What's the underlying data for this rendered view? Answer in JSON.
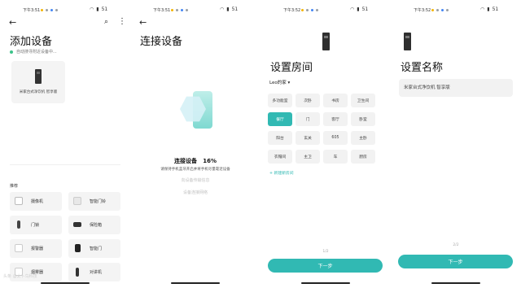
{
  "status": {
    "time_1": "下午3:51",
    "time_2": "下午3:51",
    "time_3": "下午3:52",
    "time_4": "下午3:52",
    "battery": "51"
  },
  "panel1": {
    "title": "添加设备",
    "searching": "自动搜寻附近设备中...",
    "found_device": "米家台式净饮机 智享版",
    "category_faded": "",
    "category": "推荐",
    "devices": [
      {
        "label": "摄像机",
        "icon": "camera-icon"
      },
      {
        "label": "智能门铃",
        "icon": "doorbell-icon"
      },
      {
        "label": "门锁",
        "icon": "door-lock-icon"
      },
      {
        "label": "保险箱",
        "icon": "safe-icon"
      },
      {
        "label": "报警器",
        "icon": "alarm-icon"
      },
      {
        "label": "智能门",
        "icon": "smart-door-icon"
      },
      {
        "label": "烟雾器",
        "icon": "smoke-detector-icon"
      },
      {
        "label": "对讲机",
        "icon": "walkie-talkie-icon"
      }
    ],
    "watermark": "头条 @太卜鸟科技"
  },
  "panel2": {
    "title": "连接设备",
    "progress_label": "连接设备",
    "progress_value": "16%",
    "progress_fraction": 0.16,
    "subtitle": "请保持手机蓝牙开启并将手机尽量靠近设备",
    "step1": "向设备传输信息",
    "step2": "设备连接网络"
  },
  "panel3": {
    "title": "设置房间",
    "home": "Leo的家 ▾",
    "rooms": [
      "多功能室",
      "次卧",
      "书房",
      "卫生间",
      "餐厅",
      "门",
      "客厅",
      "卧室",
      "阳台",
      "玄关",
      "605",
      "主卧",
      "衣帽间",
      "主卫",
      "车",
      "厨房"
    ],
    "selected_room": "餐厅",
    "new_room": "+ 新建新房间",
    "page": "1/2",
    "next": "下一步"
  },
  "panel4": {
    "title": "设置名称",
    "name_value": "米家台式净饮机 智享版",
    "page": "2/2",
    "next": "下一步"
  },
  "colors": {
    "accent": "#31b9b3",
    "search_dot": "#3cc38a"
  }
}
